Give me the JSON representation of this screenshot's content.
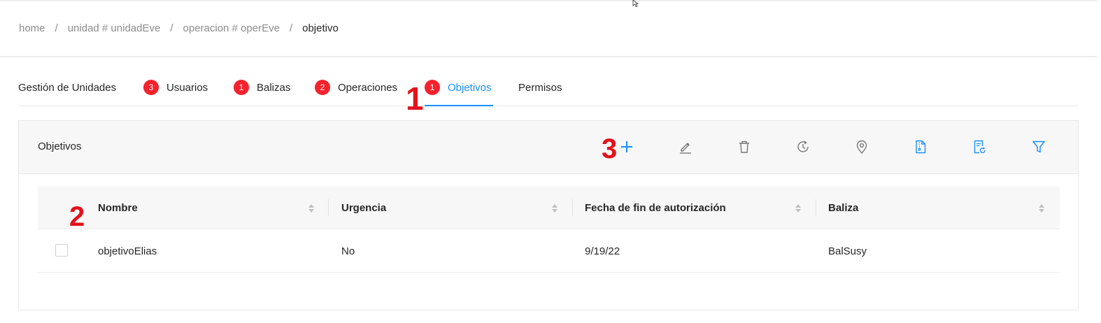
{
  "breadcrumb": {
    "items": [
      "home",
      "unidad # unidadEve",
      "operacion # operEve"
    ],
    "current": "objetivo",
    "separator": "/"
  },
  "tabs": [
    {
      "label": "Gestión de Unidades",
      "badge": ""
    },
    {
      "label": "Usuarios",
      "badge": "3"
    },
    {
      "label": "Balizas",
      "badge": "1"
    },
    {
      "label": "Operaciones",
      "badge": "2"
    },
    {
      "label": "Objetivos",
      "badge": "1",
      "active": true
    },
    {
      "label": "Permisos",
      "badge": ""
    }
  ],
  "annotations": {
    "one": "1",
    "two": "2",
    "three": "3"
  },
  "card": {
    "title": "Objetivos",
    "toolbar": [
      "plus-icon",
      "edit-icon",
      "delete-icon",
      "history-icon",
      "location-icon",
      "file-icon",
      "file-refresh-icon",
      "filter-icon"
    ]
  },
  "table": {
    "columns": [
      "Nombre",
      "Urgencia",
      "Fecha de fin de autorización",
      "Baliza"
    ],
    "rows": [
      {
        "nombre": "objetivoElias",
        "urgencia": "No",
        "fecha": "9/19/22",
        "baliza": "BalSusy"
      }
    ]
  },
  "colors": {
    "accent": "#1890ff",
    "badge": "#f5222d",
    "annotation": "#e3121b"
  }
}
